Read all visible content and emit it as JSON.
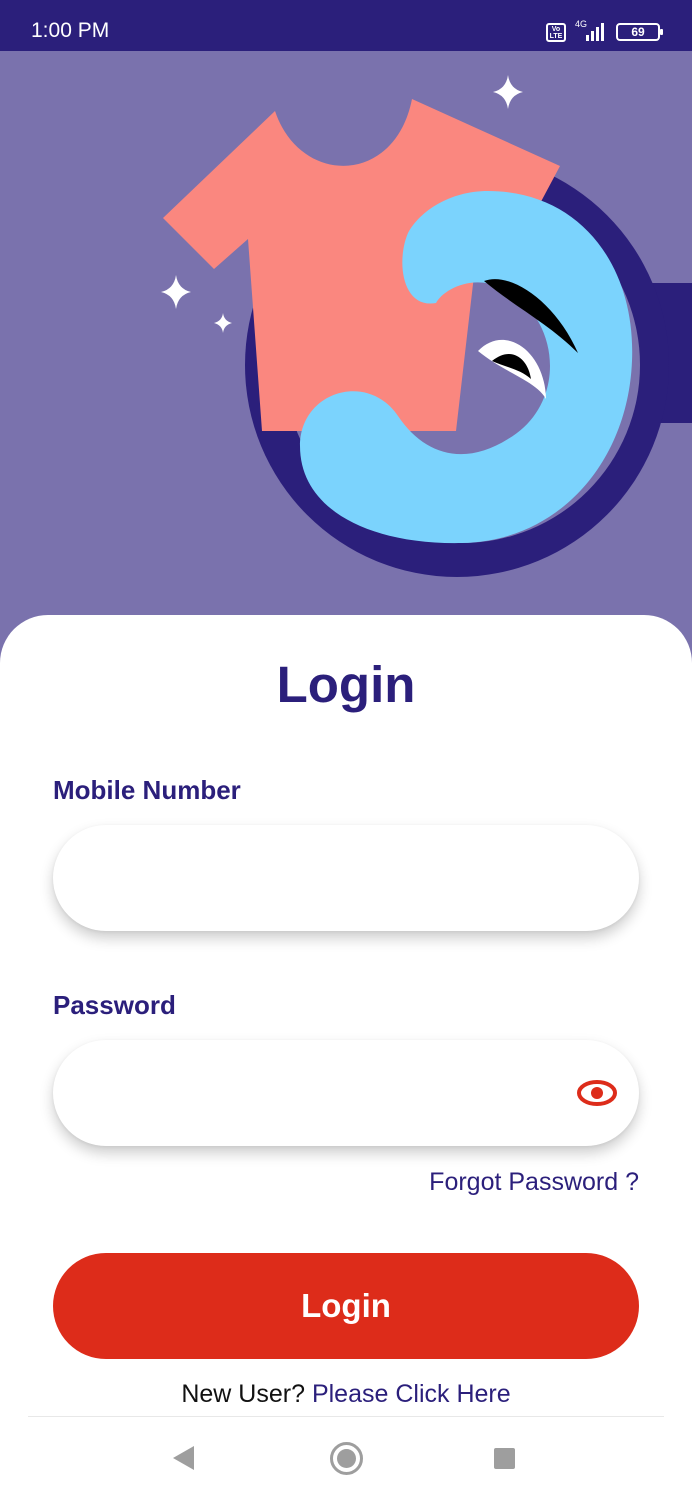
{
  "status_bar": {
    "time": "1:00 PM",
    "volte_label": "Vo LTE",
    "network_type": "4G",
    "battery_level": "69",
    "icons": [
      "volte-icon",
      "signal-icon",
      "battery-icon"
    ]
  },
  "hero": {
    "illustration": "laundry-tshirt-washing-machine-illustration",
    "colors": {
      "background": "#7a72ad",
      "drum": "#2b1f7b",
      "shirt": "#fa877f",
      "water": "#7bd3fd",
      "sparkle": "#ffffff"
    }
  },
  "login": {
    "title": "Login",
    "mobile_label": "Mobile Number",
    "mobile_value": "",
    "mobile_placeholder": "",
    "password_label": "Password",
    "password_value": "",
    "password_placeholder": "",
    "password_toggle_icon": "eye-icon",
    "forgot_password": "Forgot Password ?",
    "login_button": "Login",
    "new_user_text": "New User?",
    "new_user_link": "Please Click Here"
  },
  "nav_bar": {
    "icons": [
      "back-icon",
      "home-icon",
      "recent-apps-icon"
    ]
  },
  "colors": {
    "primary": "#2b1f7b",
    "accent": "#dd2c1a",
    "card": "#ffffff"
  }
}
